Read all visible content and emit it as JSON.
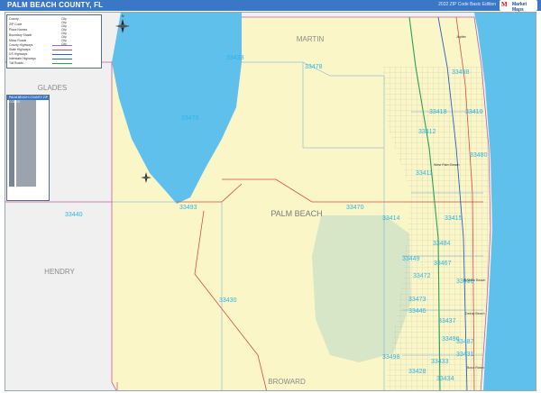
{
  "title": "PALM BEACH COUNTY, FL",
  "edition": "2022 ZIP Code Basic Edition",
  "brand_mark": "Market Maps",
  "legend": {
    "rows": [
      "County",
      "ZIP Code",
      "Place Names",
      "Boundary Shade",
      "Minor Roads",
      "County Highways",
      "State Highways",
      "US Highways",
      "Interstate Highways",
      "Toll Roads"
    ],
    "city_rows": [
      "City",
      "City",
      "City",
      "City",
      "City",
      "City",
      "City",
      "City"
    ],
    "city_colors": [
      "#d4e39a",
      "#c9d87b",
      "#bcd06a",
      "#a9c356"
    ]
  },
  "zip_list_title": "PALM BEACH COUNTY ZIP CODES",
  "colors": {
    "water": "#5fc0ec",
    "county": "#faf6c8",
    "neighbor": "#f0f0f0",
    "park": "#d6e6c6",
    "zip_label": "#2eb4e6",
    "roads": "#d84a4a"
  },
  "counties": {
    "martin": "MARTIN",
    "glades": "GLADES",
    "hendry": "HENDRY",
    "broward": "BROWARD",
    "palm_beach": "PALM BEACH"
  },
  "zip_labels": [
    {
      "code": "33438"
    },
    {
      "code": "33478"
    },
    {
      "code": "33458"
    },
    {
      "code": "33476"
    },
    {
      "code": "33418"
    },
    {
      "code": "33410"
    },
    {
      "code": "33412"
    },
    {
      "code": "33411"
    },
    {
      "code": "33493"
    },
    {
      "code": "33470"
    },
    {
      "code": "33414"
    },
    {
      "code": "33440"
    },
    {
      "code": "33449"
    },
    {
      "code": "33472"
    },
    {
      "code": "33473"
    },
    {
      "code": "33446"
    },
    {
      "code": "33496"
    },
    {
      "code": "33498"
    },
    {
      "code": "33428"
    },
    {
      "code": "33430"
    },
    {
      "code": "33484"
    },
    {
      "code": "33467"
    },
    {
      "code": "33437"
    },
    {
      "code": "33436"
    },
    {
      "code": "33431"
    },
    {
      "code": "33433"
    },
    {
      "code": "33487"
    },
    {
      "code": "33480"
    },
    {
      "code": "33415"
    },
    {
      "code": "33434"
    }
  ],
  "places": [
    "West Palm Beach",
    "Boynton Beach",
    "Delray Beach",
    "Boca Raton",
    "Jupiter"
  ],
  "compass": "N"
}
